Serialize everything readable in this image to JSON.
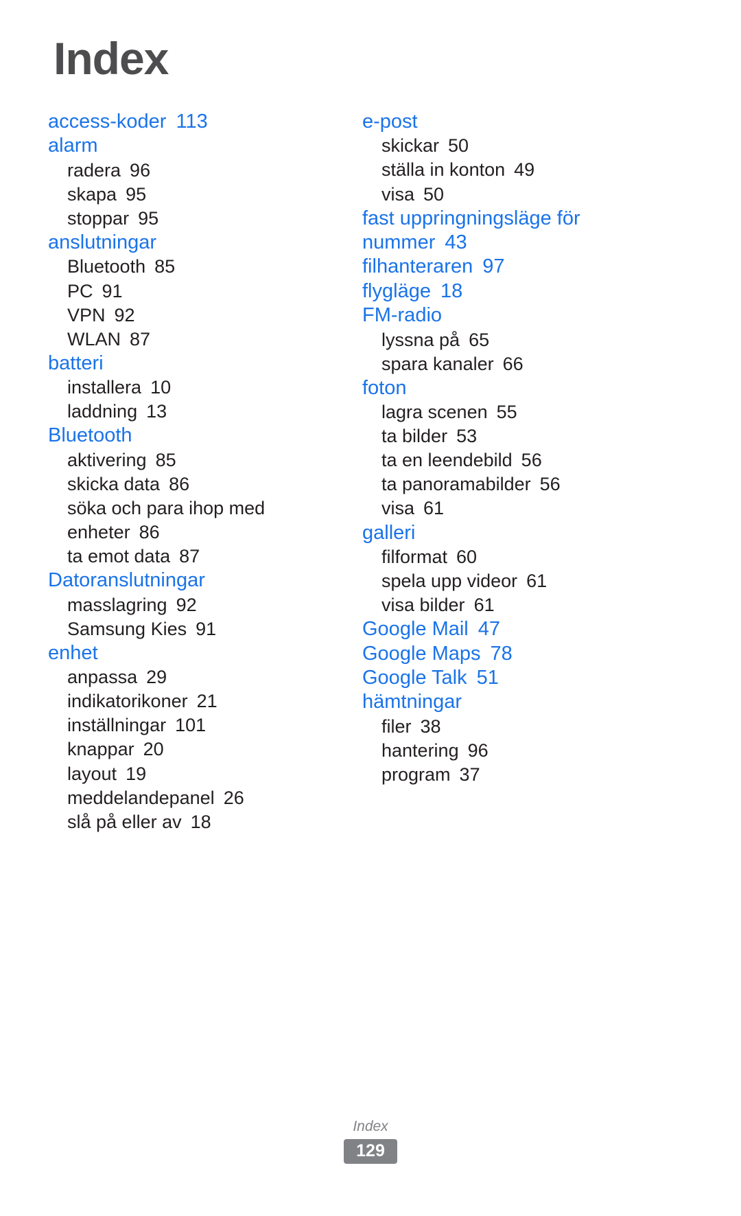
{
  "page": {
    "title": "Index",
    "footer_label": "Index",
    "footer_page_number": "129",
    "colors": {
      "heading_blue": "#1a73e8",
      "title_gray": "#4d4d4f",
      "body_black": "#231f20",
      "footer_gray": "#808285"
    }
  },
  "columns": [
    {
      "entries": [
        {
          "term": "access-koder",
          "page": "113",
          "subentries": []
        },
        {
          "term": "alarm",
          "page": "",
          "subentries": [
            {
              "term": "radera",
              "page": "96"
            },
            {
              "term": "skapa",
              "page": "95"
            },
            {
              "term": "stoppar",
              "page": "95"
            }
          ]
        },
        {
          "term": "anslutningar",
          "page": "",
          "subentries": [
            {
              "term": "Bluetooth",
              "page": "85"
            },
            {
              "term": "PC",
              "page": "91"
            },
            {
              "term": "VPN",
              "page": "92"
            },
            {
              "term": "WLAN",
              "page": "87"
            }
          ]
        },
        {
          "term": "batteri",
          "page": "",
          "subentries": [
            {
              "term": "installera",
              "page": "10"
            },
            {
              "term": "laddning",
              "page": "13"
            }
          ]
        },
        {
          "term": "Bluetooth",
          "page": "",
          "subentries": [
            {
              "term": "aktivering",
              "page": "85"
            },
            {
              "term": "skicka data",
              "page": "86"
            },
            {
              "term": "söka och para ihop med enheter",
              "page": "86"
            },
            {
              "term": "ta emot data",
              "page": "87"
            }
          ]
        },
        {
          "term": "Datoranslutningar",
          "page": "",
          "subentries": [
            {
              "term": "masslagring",
              "page": "92"
            },
            {
              "term": "Samsung Kies",
              "page": "91"
            }
          ]
        },
        {
          "term": "enhet",
          "page": "",
          "subentries": [
            {
              "term": "anpassa",
              "page": "29"
            },
            {
              "term": "indikatorikoner",
              "page": "21"
            },
            {
              "term": "inställningar",
              "page": "101"
            },
            {
              "term": "knappar",
              "page": "20"
            },
            {
              "term": "layout",
              "page": "19"
            },
            {
              "term": "meddelandepanel",
              "page": "26"
            },
            {
              "term": "slå på eller av",
              "page": "18"
            }
          ]
        }
      ]
    },
    {
      "entries": [
        {
          "term": "e-post",
          "page": "",
          "subentries": [
            {
              "term": "skickar",
              "page": "50"
            },
            {
              "term": "ställa in konton",
              "page": "49"
            },
            {
              "term": "visa",
              "page": "50"
            }
          ]
        },
        {
          "term": "fast uppringningsläge för nummer",
          "page": "43",
          "subentries": []
        },
        {
          "term": "filhanteraren",
          "page": "97",
          "subentries": []
        },
        {
          "term": "flygläge",
          "page": "18",
          "subentries": []
        },
        {
          "term": "FM-radio",
          "page": "",
          "subentries": [
            {
              "term": "lyssna på",
              "page": "65"
            },
            {
              "term": "spara kanaler",
              "page": "66"
            }
          ]
        },
        {
          "term": "foton",
          "page": "",
          "subentries": [
            {
              "term": "lagra scenen",
              "page": "55"
            },
            {
              "term": "ta bilder",
              "page": "53"
            },
            {
              "term": "ta en leendebild",
              "page": "56"
            },
            {
              "term": "ta panoramabilder",
              "page": "56"
            },
            {
              "term": "visa",
              "page": "61"
            }
          ]
        },
        {
          "term": "galleri",
          "page": "",
          "subentries": [
            {
              "term": "filformat",
              "page": "60"
            },
            {
              "term": "spela upp videor",
              "page": "61"
            },
            {
              "term": "visa bilder",
              "page": "61"
            }
          ]
        },
        {
          "term": "Google Mail",
          "page": "47",
          "subentries": []
        },
        {
          "term": "Google Maps",
          "page": "78",
          "subentries": []
        },
        {
          "term": "Google Talk",
          "page": "51",
          "subentries": []
        },
        {
          "term": "hämtningar",
          "page": "",
          "subentries": [
            {
              "term": "filer",
              "page": "38"
            },
            {
              "term": "hantering",
              "page": "96"
            },
            {
              "term": "program",
              "page": "37"
            }
          ]
        }
      ]
    }
  ]
}
